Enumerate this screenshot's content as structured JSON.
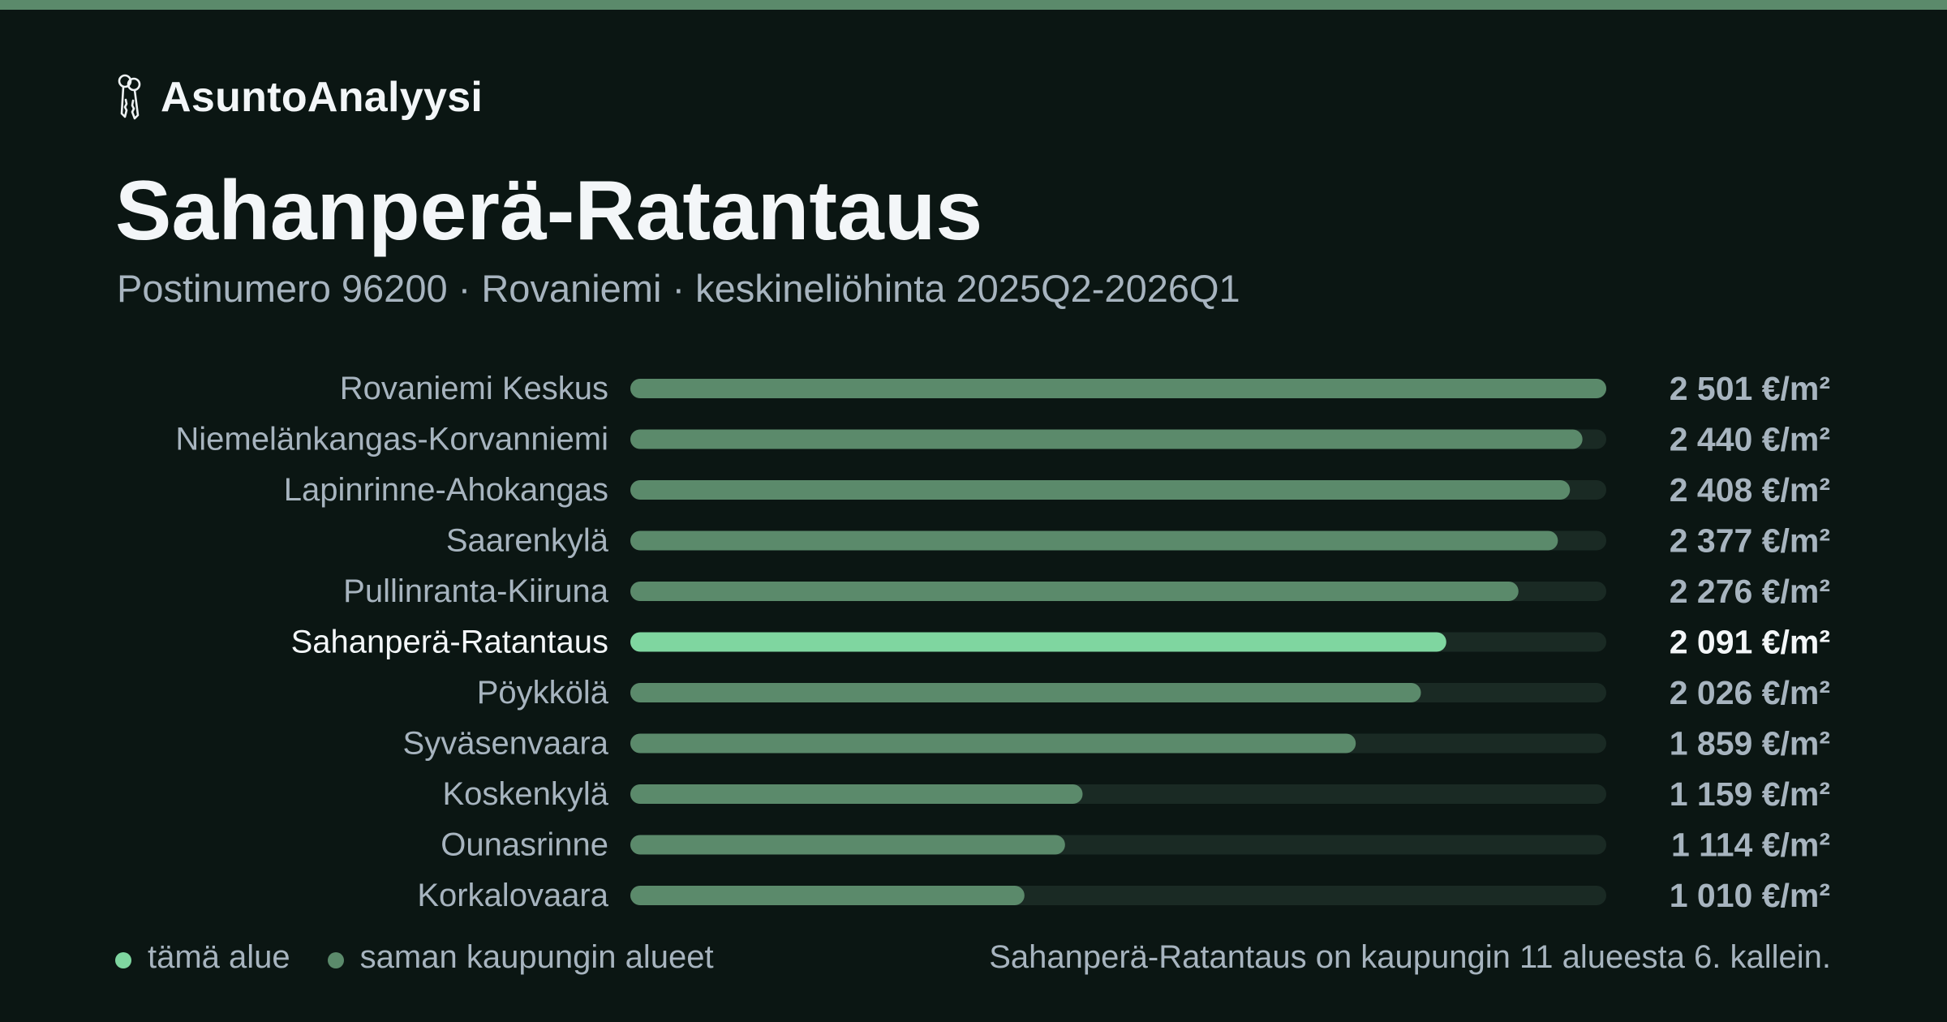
{
  "brand": {
    "name": "AsuntoAnalyysi",
    "icon": "keys-icon"
  },
  "header": {
    "title": "Sahanperä-Ratantaus",
    "subtitle": "Postinumero 96200 · Rovaniemi · keskineliöhinta 2025Q2-2026Q1"
  },
  "colors": {
    "background": "#0b1613",
    "top_strip": "#5b8a6b",
    "highlight": "#7fd6a0",
    "bar": "#5b8a6b",
    "track": "#1a2a24",
    "label": "#a7b4bf",
    "label_highlight": "#f3f6f8"
  },
  "chart_data": {
    "type": "bar",
    "orientation": "horizontal",
    "unit": "€/m²",
    "highlight": "Sahanperä-Ratantaus",
    "xlim": [
      0,
      2501
    ],
    "grid": false,
    "categories": [
      "Rovaniemi Keskus",
      "Niemelänkangas-Korvanniemi",
      "Lapinrinne-Ahokangas",
      "Saarenkylä",
      "Pullinranta-Kiiruna",
      "Sahanperä-Ratantaus",
      "Pöykkölä",
      "Syväsenvaara",
      "Koskenkylä",
      "Ounasrinne",
      "Korkalovaara"
    ],
    "values": [
      2501,
      2440,
      2408,
      2377,
      2276,
      2091,
      2026,
      1859,
      1159,
      1114,
      1010
    ],
    "value_labels": [
      "2 501 €/m²",
      "2 440 €/m²",
      "2 408 €/m²",
      "2 377 €/m²",
      "2 276 €/m²",
      "2 091 €/m²",
      "2 026 €/m²",
      "1 859 €/m²",
      "1 159 €/m²",
      "1 114 €/m²",
      "1 010 €/m²"
    ]
  },
  "legend": {
    "this_area": "tämä alue",
    "same_city": "saman kaupungin alueet"
  },
  "summary": "Sahanperä-Ratantaus on kaupungin 11 alueesta 6. kallein."
}
